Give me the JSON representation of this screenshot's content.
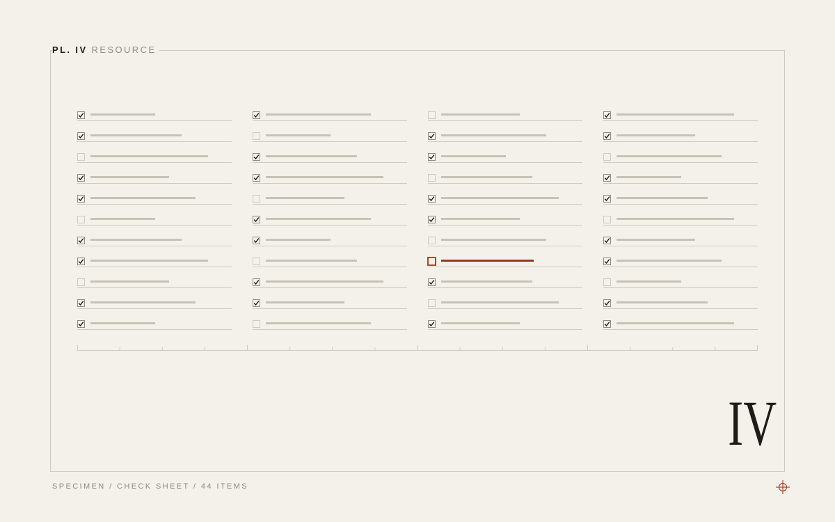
{
  "plate": {
    "label": "PL. IV",
    "subtitle": "RESOURCE"
  },
  "numeral": "IV",
  "footer": "SPECIMEN / CHECK SHEET / 44 ITEMS",
  "colors": {
    "background": "#f4f1ea",
    "rule": "#cfc9bf",
    "bar": "#c8c2b6",
    "ink": "#1e1c19",
    "muted": "#8f8a82",
    "accent": "#a8472e"
  },
  "icons": {
    "check": "check-icon",
    "registration": "crosshair-icon"
  },
  "checklist": {
    "highlight": {
      "column": 2,
      "row": 7
    },
    "columns": [
      {
        "items": [
          {
            "checked": true,
            "fill": 0.42
          },
          {
            "checked": true,
            "fill": 0.59
          },
          {
            "checked": false,
            "fill": 0.76
          },
          {
            "checked": true,
            "fill": 0.51
          },
          {
            "checked": true,
            "fill": 0.68
          },
          {
            "checked": false,
            "fill": 0.42
          },
          {
            "checked": true,
            "fill": 0.59
          },
          {
            "checked": true,
            "fill": 0.76
          },
          {
            "checked": false,
            "fill": 0.51
          },
          {
            "checked": true,
            "fill": 0.68
          },
          {
            "checked": true,
            "fill": 0.42
          }
        ]
      },
      {
        "items": [
          {
            "checked": true,
            "fill": 0.68
          },
          {
            "checked": false,
            "fill": 0.42
          },
          {
            "checked": true,
            "fill": 0.59
          },
          {
            "checked": true,
            "fill": 0.76
          },
          {
            "checked": false,
            "fill": 0.51
          },
          {
            "checked": true,
            "fill": 0.68
          },
          {
            "checked": true,
            "fill": 0.42
          },
          {
            "checked": false,
            "fill": 0.59
          },
          {
            "checked": true,
            "fill": 0.76
          },
          {
            "checked": true,
            "fill": 0.51
          },
          {
            "checked": false,
            "fill": 0.68
          }
        ]
      },
      {
        "items": [
          {
            "checked": false,
            "fill": 0.51
          },
          {
            "checked": true,
            "fill": 0.68
          },
          {
            "checked": true,
            "fill": 0.42
          },
          {
            "checked": false,
            "fill": 0.59
          },
          {
            "checked": true,
            "fill": 0.76
          },
          {
            "checked": true,
            "fill": 0.51
          },
          {
            "checked": false,
            "fill": 0.68
          },
          {
            "checked": false,
            "fill": 0.6
          },
          {
            "checked": true,
            "fill": 0.59
          },
          {
            "checked": false,
            "fill": 0.76
          },
          {
            "checked": true,
            "fill": 0.51
          }
        ]
      },
      {
        "items": [
          {
            "checked": true,
            "fill": 0.76
          },
          {
            "checked": true,
            "fill": 0.51
          },
          {
            "checked": false,
            "fill": 0.68
          },
          {
            "checked": true,
            "fill": 0.42
          },
          {
            "checked": true,
            "fill": 0.59
          },
          {
            "checked": false,
            "fill": 0.76
          },
          {
            "checked": true,
            "fill": 0.51
          },
          {
            "checked": true,
            "fill": 0.68
          },
          {
            "checked": false,
            "fill": 0.42
          },
          {
            "checked": true,
            "fill": 0.59
          },
          {
            "checked": true,
            "fill": 0.76
          }
        ]
      }
    ]
  }
}
